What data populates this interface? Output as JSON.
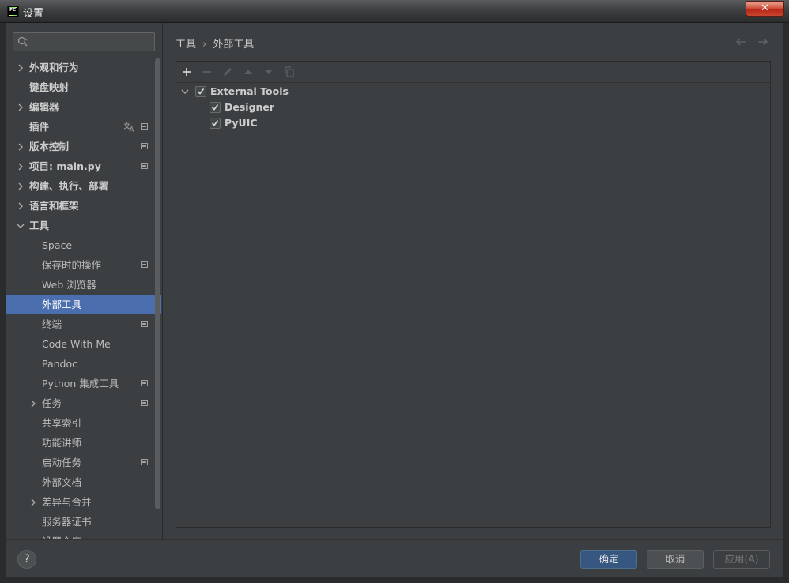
{
  "window": {
    "title": "设置",
    "close_glyph": "✕"
  },
  "search": {
    "placeholder": "",
    "value": ""
  },
  "sidebar": {
    "items": [
      {
        "label": "外观和行为",
        "level": 0,
        "expandable": true,
        "expanded": false,
        "bold": true,
        "badge": false
      },
      {
        "label": "键盘映射",
        "level": 0,
        "expandable": false,
        "bold": true,
        "badge": false
      },
      {
        "label": "编辑器",
        "level": 0,
        "expandable": true,
        "expanded": false,
        "bold": true,
        "badge": false
      },
      {
        "label": "插件",
        "level": 0,
        "expandable": false,
        "bold": true,
        "badge": true,
        "translate_icon": true
      },
      {
        "label": "版本控制",
        "level": 0,
        "expandable": true,
        "expanded": false,
        "bold": true,
        "badge": true
      },
      {
        "label": "项目: main.py",
        "level": 0,
        "expandable": true,
        "expanded": false,
        "bold": true,
        "badge": true
      },
      {
        "label": "构建、执行、部署",
        "level": 0,
        "expandable": true,
        "expanded": false,
        "bold": true,
        "badge": false
      },
      {
        "label": "语言和框架",
        "level": 0,
        "expandable": true,
        "expanded": false,
        "bold": true,
        "badge": false
      },
      {
        "label": "工具",
        "level": 0,
        "expandable": true,
        "expanded": true,
        "bold": true,
        "badge": false
      },
      {
        "label": "Space",
        "level": 1,
        "expandable": false,
        "bold": false,
        "badge": false
      },
      {
        "label": "保存时的操作",
        "level": 1,
        "expandable": false,
        "bold": false,
        "badge": true
      },
      {
        "label": "Web 浏览器",
        "level": 1,
        "expandable": false,
        "bold": false,
        "badge": false
      },
      {
        "label": "外部工具",
        "level": 1,
        "expandable": false,
        "bold": false,
        "badge": false,
        "selected": true
      },
      {
        "label": "终端",
        "level": 1,
        "expandable": false,
        "bold": false,
        "badge": true
      },
      {
        "label": "Code With Me",
        "level": 1,
        "expandable": false,
        "bold": false,
        "badge": false
      },
      {
        "label": "Pandoc",
        "level": 1,
        "expandable": false,
        "bold": false,
        "badge": false
      },
      {
        "label": "Python 集成工具",
        "level": 1,
        "expandable": false,
        "bold": false,
        "badge": true
      },
      {
        "label": "任务",
        "level": 1,
        "expandable": true,
        "expanded": false,
        "bold": false,
        "badge": true
      },
      {
        "label": "共享索引",
        "level": 1,
        "expandable": false,
        "bold": false,
        "badge": false
      },
      {
        "label": "功能讲师",
        "level": 1,
        "expandable": false,
        "bold": false,
        "badge": false
      },
      {
        "label": "启动任务",
        "level": 1,
        "expandable": false,
        "bold": false,
        "badge": true
      },
      {
        "label": "外部文档",
        "level": 1,
        "expandable": false,
        "bold": false,
        "badge": false
      },
      {
        "label": "差异与合并",
        "level": 1,
        "expandable": true,
        "expanded": false,
        "bold": false,
        "badge": false
      },
      {
        "label": "服务器证书",
        "level": 1,
        "expandable": false,
        "bold": false,
        "badge": false
      },
      {
        "label": "设置仓库",
        "level": 1,
        "expandable": false,
        "bold": false,
        "badge": false
      }
    ]
  },
  "breadcrumb": {
    "parent": "工具",
    "separator": "›",
    "current": "外部工具"
  },
  "toolbar": {
    "buttons": [
      {
        "name": "add-icon",
        "enabled": true
      },
      {
        "name": "remove-icon",
        "enabled": false
      },
      {
        "name": "edit-icon",
        "enabled": false
      },
      {
        "name": "move-up-icon",
        "enabled": false
      },
      {
        "name": "move-down-icon",
        "enabled": false
      },
      {
        "name": "copy-icon",
        "enabled": false
      }
    ]
  },
  "tools_tree": {
    "group": {
      "label": "External Tools",
      "checked": true,
      "expanded": true
    },
    "items": [
      {
        "label": "Designer",
        "checked": true
      },
      {
        "label": "PyUIC",
        "checked": true
      }
    ]
  },
  "footer": {
    "help_label": "?",
    "ok_label": "确定",
    "cancel_label": "取消",
    "apply_label": "应用(A)"
  },
  "colors": {
    "background": "#3c3f41",
    "selection": "#4b6eaf",
    "primary_button": "#365880",
    "text": "#bbbbbb"
  }
}
